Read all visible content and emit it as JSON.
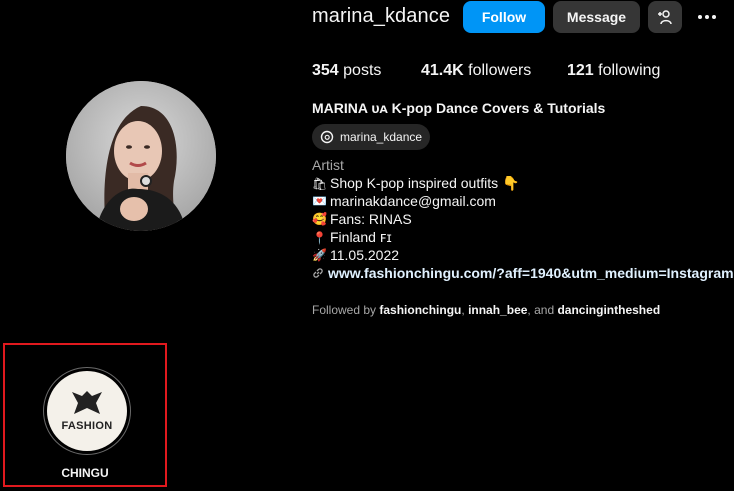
{
  "profile": {
    "username": "marina_kdance",
    "full_name": "MARINA ᴜᴀ K-pop Dance Covers & Tutorials",
    "threads_handle": "marina_kdance",
    "category": "Artist"
  },
  "actions": {
    "follow_label": "Follow",
    "message_label": "Message"
  },
  "stats": {
    "posts_count": "354",
    "posts_label": "posts",
    "followers_count": "41.4K",
    "followers_label": "followers",
    "following_count": "121",
    "following_label": "following"
  },
  "bio": {
    "line1": "Shop K-pop inspired outfits 👇",
    "line2": "marinakdance@gmail.com",
    "line3": "Fans: RINAS",
    "line4": "Finland ꜰɪ",
    "line5": "11.05.2022",
    "link": "www.fashionchingu.com/?aff=1940&utm_medium=Instagram&u"
  },
  "followed_by": {
    "prefix": "Followed by",
    "user1": "fashionchingu",
    "sep1": ",",
    "user2": "innah_bee",
    "sep2": ", and",
    "user3": "dancingintheshed"
  },
  "highlight": {
    "logo_text": "FASHION",
    "label": "CHINGU"
  },
  "colors": {
    "accent": "#0095f6",
    "selection_box": "#e0191e"
  },
  "icons": {
    "threads": "threads-icon",
    "add_person": "add-person-icon",
    "more": "more-horizontal-icon",
    "link": "link-icon"
  }
}
